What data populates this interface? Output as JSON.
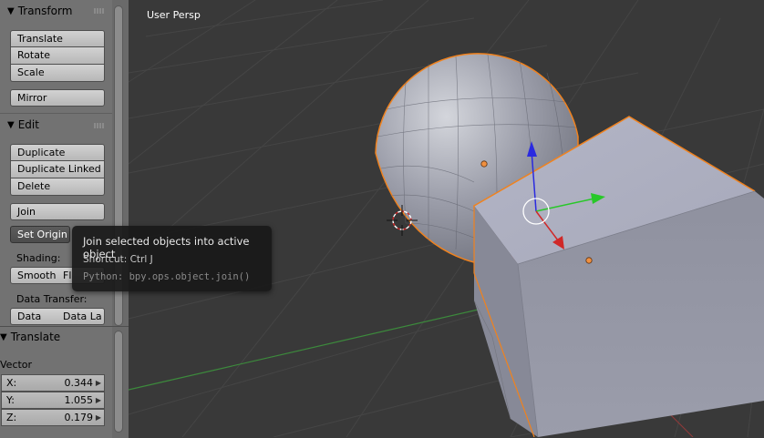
{
  "viewport": {
    "label": "User Persp"
  },
  "transform_panel": {
    "title": "Transform",
    "buttons": [
      "Translate",
      "Rotate",
      "Scale"
    ],
    "mirror": "Mirror"
  },
  "edit_panel": {
    "title": "Edit",
    "buttons": [
      "Duplicate",
      "Duplicate Linked",
      "Delete"
    ],
    "join": "Join",
    "set_origin": "Set Origin",
    "shading_label": "Shading:",
    "shading_smooth": "Smooth",
    "shading_flat": "Fl",
    "data_transfer_label": "Data Transfer:",
    "data_transfer_data": "Data",
    "data_transfer_layout": "Data La"
  },
  "redo_panel": {
    "title": "Translate",
    "vector_label": "Vector",
    "fields": [
      {
        "key": "X:",
        "value": "0.344"
      },
      {
        "key": "Y:",
        "value": "1.055"
      },
      {
        "key": "Z:",
        "value": "0.179"
      }
    ]
  },
  "tooltip": {
    "title": "Join selected objects into active object",
    "shortcut": "Shortcut: Ctrl J",
    "python": "Python: bpy.ops.object.join()"
  },
  "colors": {
    "viewport_bg": "#393939",
    "shelf_bg": "#727272",
    "selection_outline": "#f0821e",
    "axis_x": "#d03030",
    "axis_y": "#2fc92f",
    "axis_z": "#2020e0"
  },
  "icons": [
    "disclosure-triangle-icon",
    "grip-icon",
    "3d-cursor-icon",
    "origin-dot-icon",
    "transform-gizmo-icon"
  ]
}
